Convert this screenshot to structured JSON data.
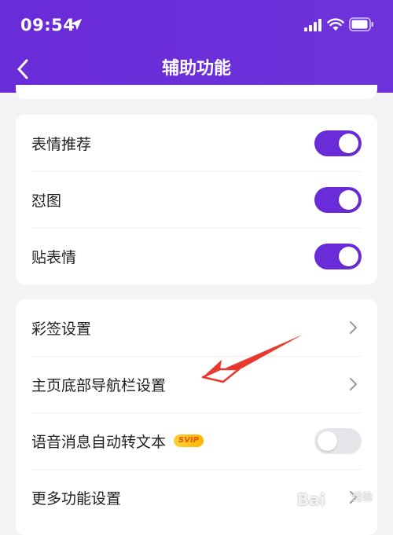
{
  "status_bar": {
    "time": "09:54",
    "location_icon": "location-arrow-icon",
    "signal_icon": "cellular-signal-icon",
    "wifi_icon": "wifi-icon",
    "battery_icon": "battery-icon"
  },
  "header": {
    "title": "辅助功能",
    "back_icon": "chevron-left-icon",
    "accent_color": "#6a2bd8"
  },
  "toggle_section": {
    "items": [
      {
        "label": "表情推荐",
        "enabled": true
      },
      {
        "label": "怼图",
        "enabled": true
      },
      {
        "label": "贴表情",
        "enabled": true
      }
    ]
  },
  "settings_section": {
    "items": [
      {
        "label": "彩签设置",
        "type": "link"
      },
      {
        "label": "主页底部导航栏设置",
        "type": "link"
      },
      {
        "label": "语音消息自动转文本",
        "type": "toggle",
        "enabled": false,
        "badge": "SVIP"
      },
      {
        "label": "更多功能设置",
        "type": "link"
      }
    ]
  },
  "annotation": {
    "arrow_color": "#e8392f"
  },
  "watermark": {
    "brand": "Bai",
    "suffix": "经验"
  }
}
